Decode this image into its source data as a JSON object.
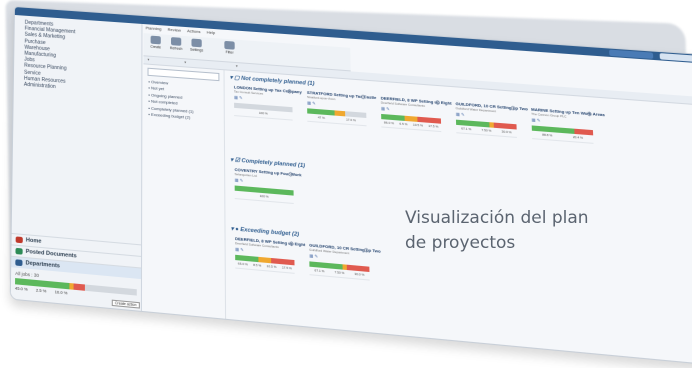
{
  "caption": {
    "line1": "Visualización del plan",
    "line2": "de proyectos"
  },
  "colors": {
    "green": "#5cb85c",
    "orange": "#f0a830",
    "red": "#e05a4f",
    "grey": "#d3d8de",
    "blue": "#2f5d8f"
  },
  "ribbon": {
    "tabs": [
      "Planning",
      "Review",
      "Actions",
      "Help"
    ],
    "buttons": [
      {
        "label": "Create"
      },
      {
        "label": "Refresh"
      },
      {
        "label": "Settings"
      },
      {
        "label": "Filter"
      }
    ]
  },
  "sidebar": {
    "nav": [
      "Departments",
      "Financial Management",
      "Sales & Marketing",
      "Purchase",
      "Warehouse",
      "Manufacturing",
      "Jobs",
      "Resource Planning",
      "Service",
      "Human Resources",
      "Administration"
    ],
    "bottom_items": [
      "Home",
      "Posted Documents",
      "Departments"
    ],
    "mini_label": "All jobs : 30",
    "mini_percents": [
      "45.0 %",
      "2.5 %",
      "10.0 %"
    ],
    "tooltip": "Create action"
  },
  "tree": {
    "items": [
      "Overview",
      "Not yet",
      "Ongoing planned",
      "Not completed",
      "Completely planned (1)",
      "Exceeding budget (2)"
    ]
  },
  "groups": {
    "g1": {
      "title": "Not completely planned (1)"
    },
    "g2": {
      "title": "Completely planned (1)"
    },
    "g3": {
      "title": "Exceeding budget (2)"
    }
  },
  "cards": {
    "c1": {
      "title": "LONDON Setting up Tax Company",
      "sub": "Tax Consult Services",
      "pct": [
        "100 %"
      ]
    },
    "c2": {
      "title": "STRATFORD Setting up Tax Castle",
      "sub": "Stratford-upon-Avon",
      "pct": [
        "47 %",
        "17.0 %"
      ]
    },
    "c3": {
      "title": "DEERFIELD, 8 WP Setting up Eight",
      "sub": "Deerfield Software Consultants",
      "pct": [
        "86.0 %",
        "6.5 %",
        "10.5 %",
        "17.5 %"
      ]
    },
    "c4": {
      "title": "GUILDFORD, 10 CR Setting up Two",
      "sub": "Guildford Water Department",
      "pct": [
        "67.1 %",
        "7.50 %",
        "30.0 %"
      ]
    },
    "c5": {
      "title": "MARINE Setting up Ten Work Areas",
      "sub": "The Cannon Group PLC",
      "pct": [
        "88.8 %",
        "20.4 %"
      ]
    },
    "c6": {
      "title": "COVENTRY Setting up Four Work",
      "sub": "Selangorian Ltd.",
      "pct": [
        "100 %"
      ]
    },
    "c7": {
      "title": "DEERFIELD, 8 WP Setting up Eight",
      "sub": "Deerfield Software Consultants",
      "pct": [
        "65.0 %",
        "8.5 %",
        "10.5 %",
        "17.5 %"
      ]
    },
    "c8": {
      "title": "GUILDFORD, 10 CR Setting up Two",
      "sub": "Guildford Water Department",
      "pct": [
        "67.1 %",
        "7.50 %",
        "30.0 %"
      ]
    }
  }
}
